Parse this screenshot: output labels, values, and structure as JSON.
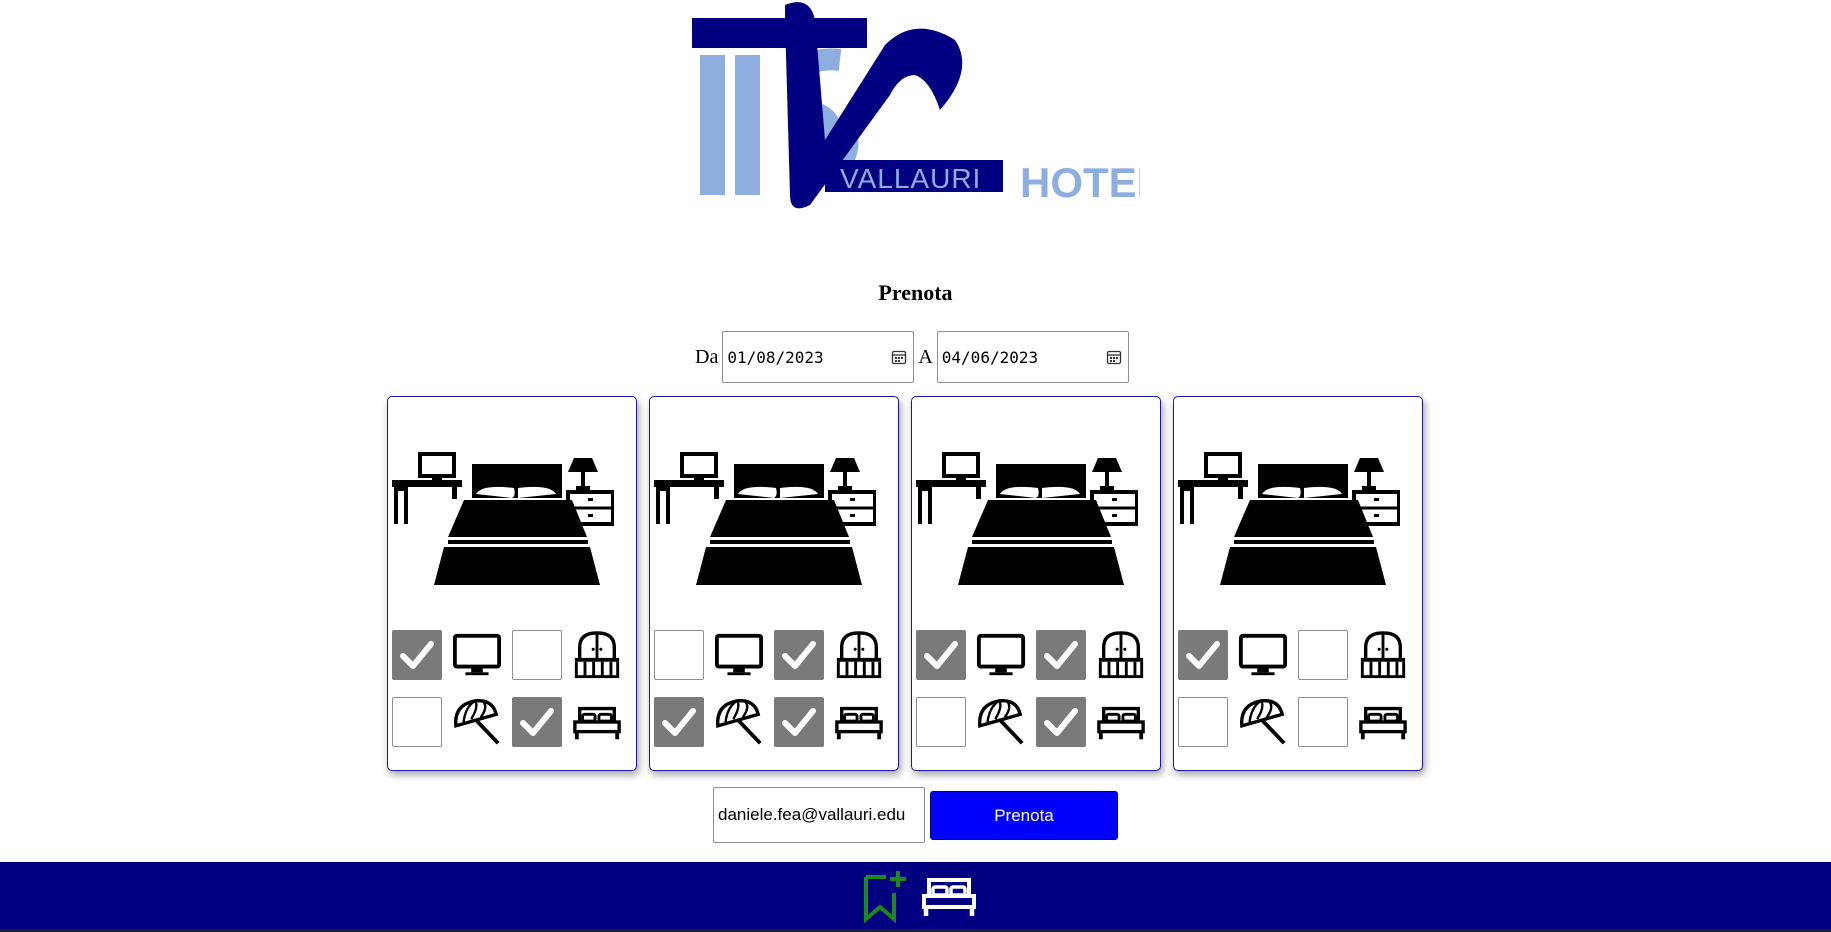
{
  "logo": {
    "brand": "VALLAURI",
    "suffix": "HOTEL"
  },
  "page_title": "Prenota",
  "dates": {
    "from_label": "Da",
    "from_value": "01/08/2023",
    "to_label": "A",
    "to_value": "04/06/2023"
  },
  "rooms": [
    {
      "amenities": {
        "tv": true,
        "balcony": false,
        "sea_view": false,
        "double_bed": true
      }
    },
    {
      "amenities": {
        "tv": false,
        "balcony": true,
        "sea_view": true,
        "double_bed": true
      }
    },
    {
      "amenities": {
        "tv": true,
        "balcony": true,
        "sea_view": false,
        "double_bed": true
      }
    },
    {
      "amenities": {
        "tv": true,
        "balcony": false,
        "sea_view": false,
        "double_bed": false
      }
    }
  ],
  "email": {
    "value": "daniele.fea@vallauri.edu"
  },
  "book_button": {
    "label": "Prenota"
  },
  "colors": {
    "primary_button": "#0000ff",
    "nav_bar": "#000080",
    "checked_box": "#7a7a7a",
    "bookmark_icon": "#1a8a1a",
    "logo_dark": "#000080",
    "logo_light": "#8eaee0"
  },
  "icons": {
    "bottom_nav": [
      "bookmark-add-icon",
      "bed-icon"
    ],
    "amenities": [
      "tv-icon",
      "window-icon",
      "beach-umbrella-icon",
      "double-bed-icon"
    ]
  }
}
